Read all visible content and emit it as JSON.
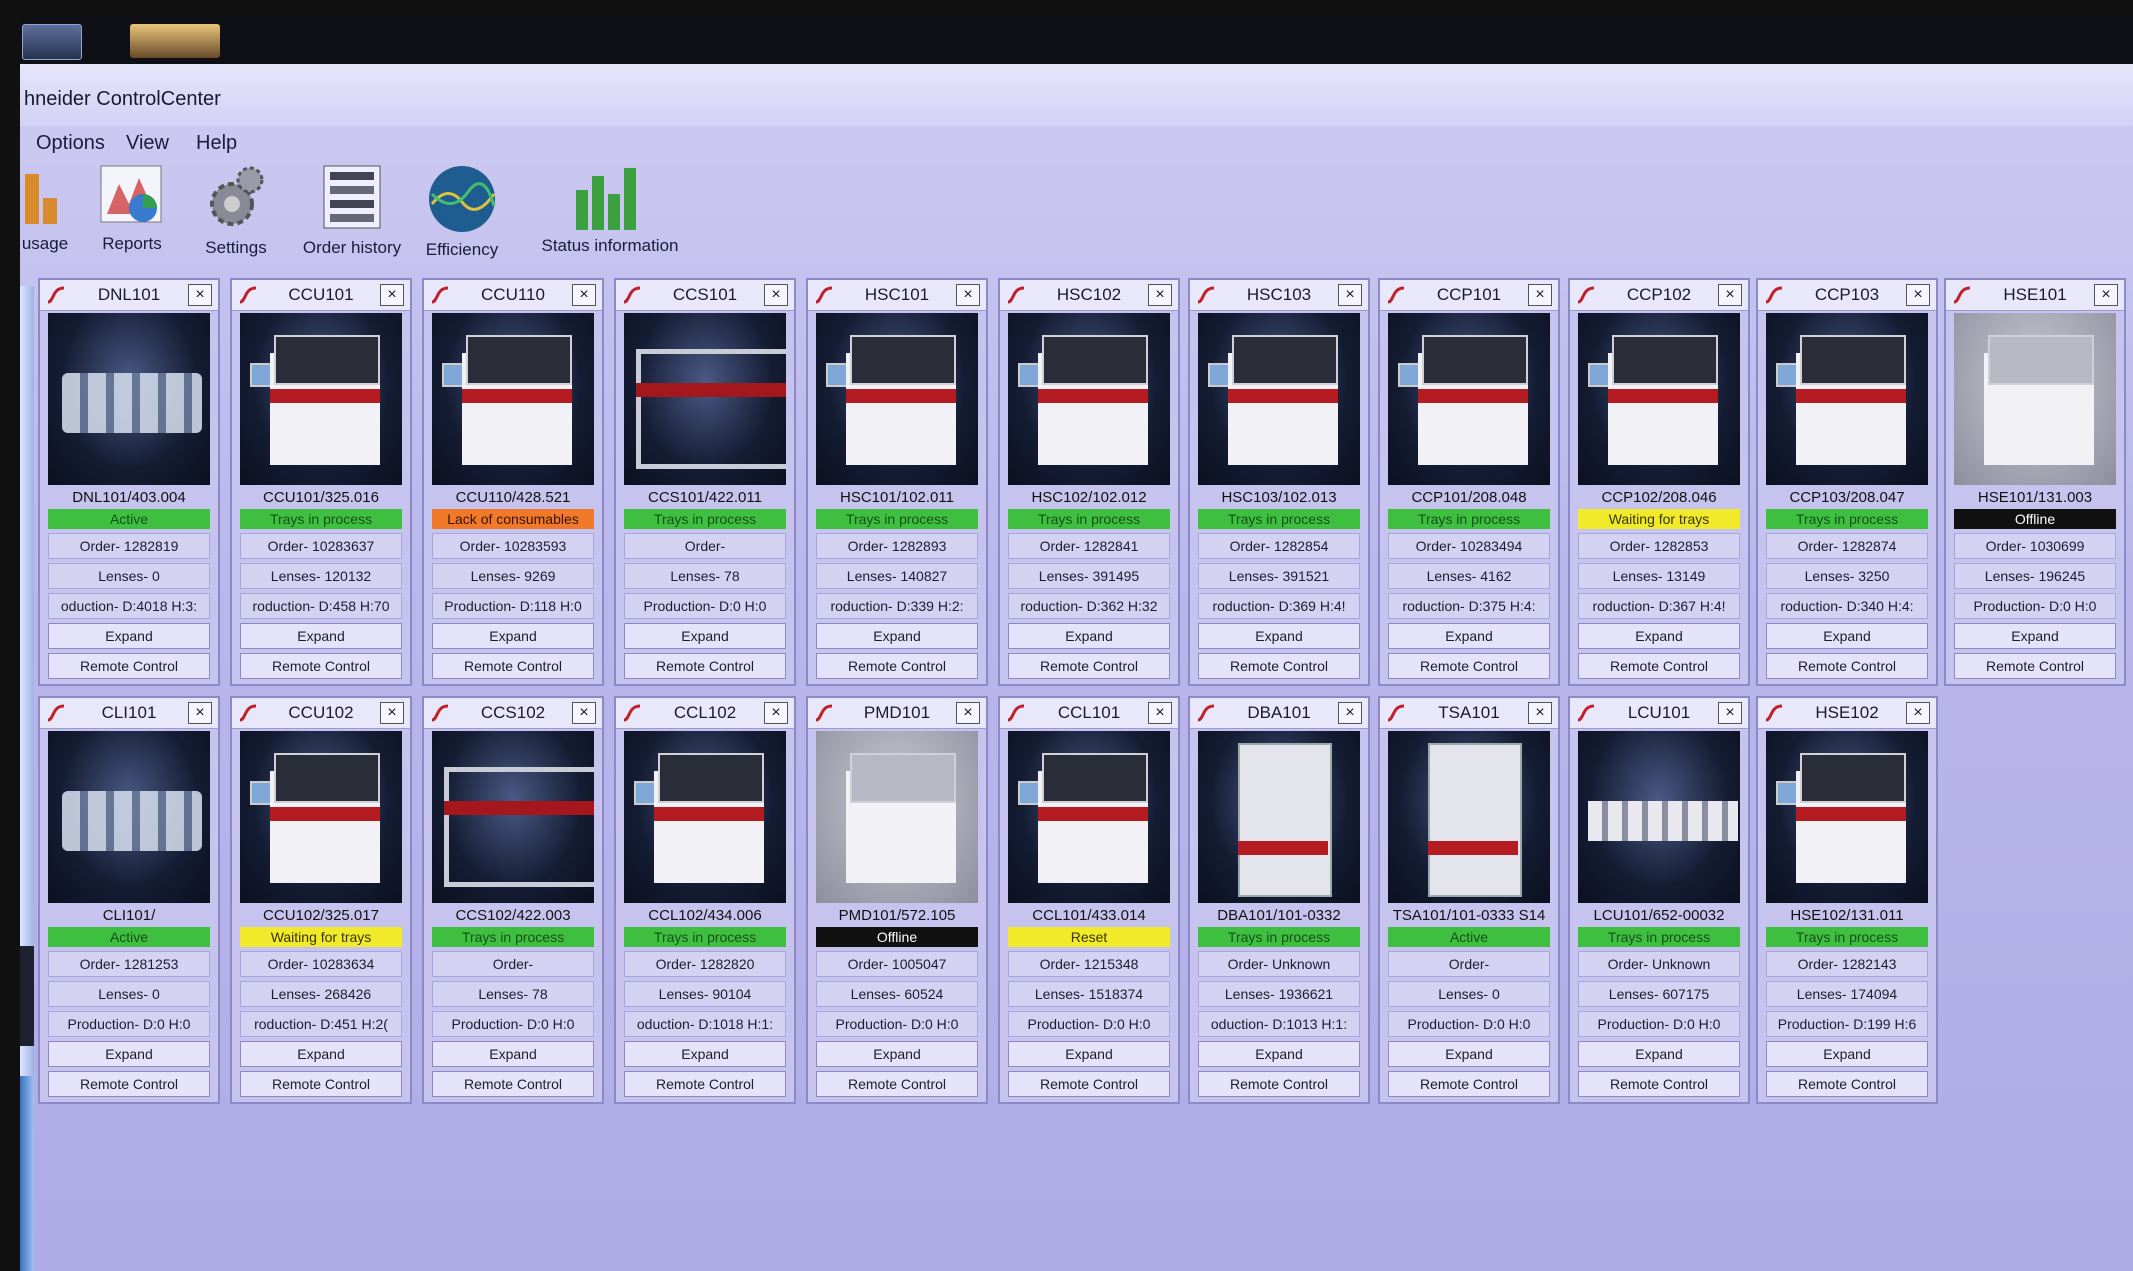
{
  "window": {
    "title": "hneider ControlCenter"
  },
  "menu": [
    "Options",
    "View",
    "Help"
  ],
  "toolbar": [
    {
      "label": "usage",
      "icon": "usage-chart-icon"
    },
    {
      "label": "Reports",
      "icon": "reports-chart-icon"
    },
    {
      "label": "Settings",
      "icon": "gears-icon"
    },
    {
      "label": "Order history",
      "icon": "order-history-icon"
    },
    {
      "label": "Efficiency",
      "icon": "efficiency-globe-icon"
    },
    {
      "label": "Status information",
      "icon": "status-bars-icon"
    }
  ],
  "colors": {
    "green": "#3fbf3f",
    "yellow": "#f1ea2a",
    "orange": "#f07a2a",
    "black": "#111111"
  },
  "machines": [
    {
      "name": "DNL101",
      "id": "DNL101/403.004",
      "status": "Active",
      "status_color": "green",
      "order": "Order- 1282819",
      "lenses": "Lenses- 0",
      "production": "oduction- D:4018 H:3:",
      "img": "conveyor"
    },
    {
      "name": "CCU101",
      "id": "CCU101/325.016",
      "status": "Trays in process",
      "status_color": "green",
      "order": "Order- 10283637",
      "lenses": "Lenses- 120132",
      "production": "roduction- D:458 H:70",
      "img": "coater"
    },
    {
      "name": "CCU110",
      "id": "CCU110/428.521",
      "status": "Lack of consumables",
      "status_color": "orange",
      "order": "Order- 10283593",
      "lenses": "Lenses- 9269",
      "production": "Production- D:118 H:0",
      "img": "coater"
    },
    {
      "name": "CCS101",
      "id": "CCS101/422.011",
      "status": "Trays in process",
      "status_color": "green",
      "order": "Order-",
      "lenses": "Lenses- 78",
      "production": "Production- D:0 H:0",
      "img": "frame"
    },
    {
      "name": "HSC101",
      "id": "HSC101/102.011",
      "status": "Trays in process",
      "status_color": "green",
      "order": "Order- 1282893",
      "lenses": "Lenses- 140827",
      "production": "roduction- D:339 H:2:",
      "img": "coater"
    },
    {
      "name": "HSC102",
      "id": "HSC102/102.012",
      "status": "Trays in process",
      "status_color": "green",
      "order": "Order- 1282841",
      "lenses": "Lenses- 391495",
      "production": "roduction- D:362 H:32",
      "img": "coater"
    },
    {
      "name": "HSC103",
      "id": "HSC103/102.013",
      "status": "Trays in process",
      "status_color": "green",
      "order": "Order- 1282854",
      "lenses": "Lenses- 391521",
      "production": "roduction- D:369 H:4!",
      "img": "coater"
    },
    {
      "name": "CCP101",
      "id": "CCP101/208.048",
      "status": "Trays in process",
      "status_color": "green",
      "order": "Order- 10283494",
      "lenses": "Lenses- 4162",
      "production": "roduction- D:375 H:4:",
      "img": "coater"
    },
    {
      "name": "CCP102",
      "id": "CCP102/208.046",
      "status": "Waiting for trays",
      "status_color": "yellow",
      "order": "Order- 1282853",
      "lenses": "Lenses- 13149",
      "production": "roduction- D:367 H:4!",
      "img": "coater"
    },
    {
      "name": "CCP103",
      "id": "CCP103/208.047",
      "status": "Trays in process",
      "status_color": "green",
      "order": "Order- 1282874",
      "lenses": "Lenses- 3250",
      "production": "roduction- D:340 H:4:",
      "img": "coater"
    },
    {
      "name": "HSE101",
      "id": "HSE101/131.003",
      "status": "Offline",
      "status_color": "black",
      "order": "Order- 1030699",
      "lenses": "Lenses- 196245",
      "production": "Production- D:0 H:0",
      "img": "gray"
    },
    {
      "name": "CLI101",
      "id": "CLI101/",
      "status": "Active",
      "status_color": "green",
      "order": "Order- 1281253",
      "lenses": "Lenses- 0",
      "production": "Production- D:0 H:0",
      "img": "conveyor"
    },
    {
      "name": "CCU102",
      "id": "CCU102/325.017",
      "status": "Waiting for trays",
      "status_color": "yellow",
      "order": "Order- 10283634",
      "lenses": "Lenses- 268426",
      "production": "roduction- D:451 H:2(",
      "img": "coater"
    },
    {
      "name": "CCS102",
      "id": "CCS102/422.003",
      "status": "Trays in process",
      "status_color": "green",
      "order": "Order-",
      "lenses": "Lenses- 78",
      "production": "Production- D:0 H:0",
      "img": "frame"
    },
    {
      "name": "CCL102",
      "id": "CCL102/434.006",
      "status": "Trays in process",
      "status_color": "green",
      "order": "Order- 1282820",
      "lenses": "Lenses- 90104",
      "production": "oduction- D:1018 H:1:",
      "img": "coater"
    },
    {
      "name": "PMD101",
      "id": "PMD101/572.105",
      "status": "Offline",
      "status_color": "black",
      "order": "Order- 1005047",
      "lenses": "Lenses- 60524",
      "production": "Production- D:0 H:0",
      "img": "gray"
    },
    {
      "name": "CCL101",
      "id": "CCL101/433.014",
      "status": "Reset",
      "status_color": "yellow",
      "order": "Order- 1215348",
      "lenses": "Lenses- 1518374",
      "production": "Production- D:0 H:0",
      "img": "coater"
    },
    {
      "name": "DBA101",
      "id": "DBA101/101-0332",
      "status": "Trays in process",
      "status_color": "green",
      "order": "Order- Unknown",
      "lenses": "Lenses- 1936621",
      "production": "oduction- D:1013 H:1:",
      "img": "tall"
    },
    {
      "name": "TSA101",
      "id": "TSA101/101-0333 S14",
      "status": "Active",
      "status_color": "green",
      "order": "Order-",
      "lenses": "Lenses- 0",
      "production": "Production- D:0 H:0",
      "img": "tall"
    },
    {
      "name": "LCU101",
      "id": "LCU101/652-00032",
      "status": "Trays in process",
      "status_color": "green",
      "order": "Order- Unknown",
      "lenses": "Lenses- 607175",
      "production": "Production- D:0 H:0",
      "img": "line"
    },
    {
      "name": "HSE102",
      "id": "HSE102/131.011",
      "status": "Trays in process",
      "status_color": "green",
      "order": "Order- 1282143",
      "lenses": "Lenses- 174094",
      "production": "Production- D:199 H:6",
      "img": "coater"
    }
  ],
  "labels": {
    "expand": "Expand",
    "remote": "Remote Control",
    "close": "×"
  }
}
